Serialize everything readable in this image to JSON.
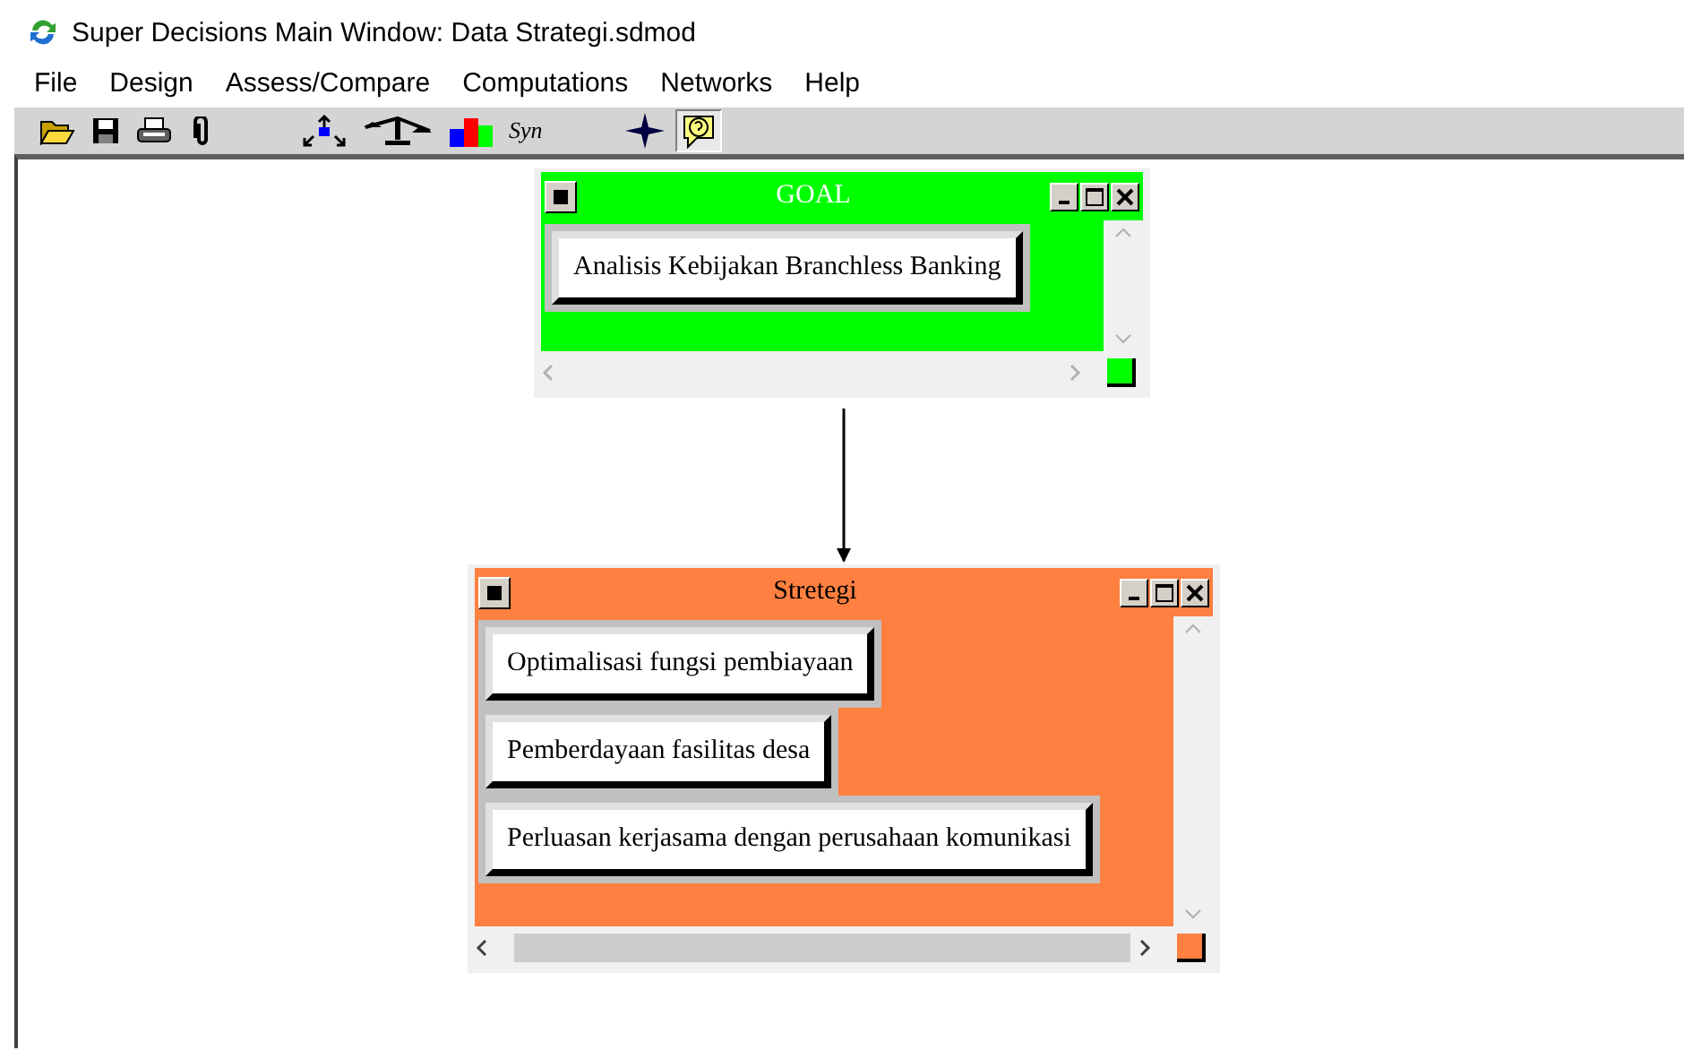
{
  "window": {
    "title": "Super Decisions Main Window: Data Strategi.sdmod"
  },
  "menu": [
    "File",
    "Design",
    "Assess/Compare",
    "Computations",
    "Networks",
    "Help"
  ],
  "toolbar": [
    {
      "kind": "open",
      "selected": false
    },
    {
      "kind": "save",
      "selected": false
    },
    {
      "kind": "print",
      "selected": false
    },
    {
      "kind": "clip",
      "selected": false
    },
    {
      "kind": "gap"
    },
    {
      "kind": "hierarchy",
      "selected": false
    },
    {
      "kind": "balance",
      "selected": false
    },
    {
      "kind": "bars",
      "selected": false
    },
    {
      "kind": "text",
      "label": "Syn",
      "selected": false
    },
    {
      "kind": "gap"
    },
    {
      "kind": "compass",
      "selected": false
    },
    {
      "kind": "help",
      "selected": true
    }
  ],
  "clusters": [
    {
      "title": "GOAL",
      "color": "#00ff00",
      "nodes": [
        "Analisis Kebijakan Branchless Banking"
      ]
    },
    {
      "title": "Stretegi",
      "color": "#ff8040",
      "nodes": [
        "Optimalisasi fungsi pembiayaan",
        "Pemberdayaan fasilitas desa",
        "Perluasan kerjasama dengan perusahaan komunikasi"
      ]
    }
  ]
}
